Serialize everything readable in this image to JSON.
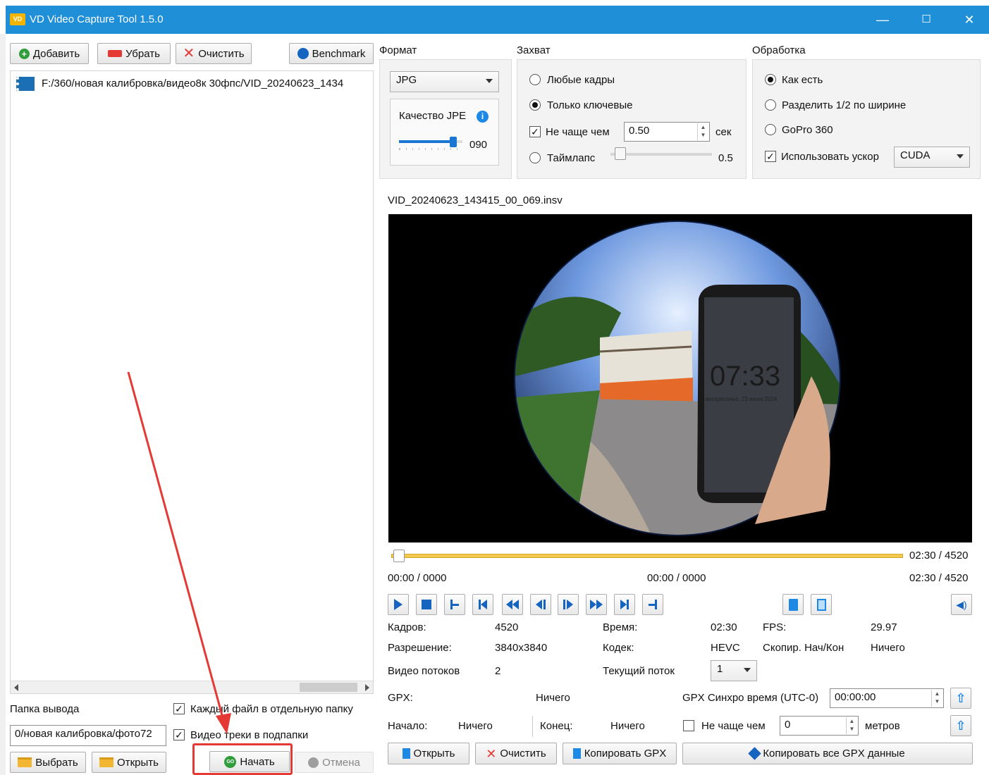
{
  "window": {
    "app_logo": "VD",
    "title": "VD Video Capture Tool 1.5.0",
    "controls": {
      "minimize": "—",
      "maximize": "☐",
      "close": "✕"
    }
  },
  "toolbar": {
    "add_label": "Добавить",
    "remove_label": "Убрать",
    "clear_label": "Очистить",
    "benchmark_label": "Benchmark"
  },
  "file_list": {
    "items": [
      {
        "path": "F:/360/новая калибровка/видео8к 30фпс/VID_20240623_1434"
      }
    ]
  },
  "output": {
    "folder_label": "Папка вывода",
    "folder_value": "0/новая калибровка/фото72",
    "each_file_folder_label": "Каждый файл в отдельную папку",
    "each_file_folder_checked": true,
    "video_tracks_label": "Видео треки в подпапки",
    "video_tracks_checked": true,
    "choose_label": "Выбрать",
    "open_label": "Открыть",
    "start_label": "Начать",
    "start_icon": "GO",
    "cancel_label": "Отмена"
  },
  "format": {
    "group_label": "Формат",
    "selected": "JPG",
    "quality_label": "Качество JPE",
    "quality_value": "090",
    "quality_level": 90
  },
  "capture": {
    "group_label": "Захват",
    "any_frames_label": "Любые кадры",
    "key_only_label": "Только ключевые",
    "selected_mode": "key_only",
    "not_more_label": "Не чаще чем",
    "not_more_checked": true,
    "not_more_value": "0.50",
    "unit_label": "сек",
    "timelapse_label": "Таймлапс",
    "timelapse_value": "0.5",
    "timelapse_level": 0.05
  },
  "processing": {
    "group_label": "Обработка",
    "as_is_label": "Как есть",
    "split_label": "Разделить 1/2 по ширине",
    "gopro_label": "GoPro 360",
    "selected_mode": "as_is",
    "accel_label": "Использовать ускор",
    "accel_checked": true,
    "accel_value": "CUDA"
  },
  "preview": {
    "filename": "VID_20240623_143415_00_069.insv",
    "phone_time": "07:33",
    "phone_date": "воскресенье, 23 июня 2024",
    "slider_time": "02:30 / 4520",
    "slider_progress": 0.01,
    "pos_start": "00:00 / 0000",
    "pos_mid": "00:00 / 0000",
    "pos_end": "02:30 / 4520"
  },
  "info": {
    "frames_label": "Кадров:",
    "frames_value": "4520",
    "time_label": "Время:",
    "time_value": "02:30",
    "fps_label": "FPS:",
    "fps_value": "29.97",
    "resolution_label": "Разрешение:",
    "resolution_value": "3840x3840",
    "codec_label": "Кодек:",
    "codec_value": "HEVC",
    "copy_label": "Скопир. Нач/Кон",
    "copy_value": "Ничего",
    "streams_label": "Видео потоков",
    "streams_value": "2",
    "current_stream_label": "Текущий поток",
    "current_stream_value": "1"
  },
  "gpx": {
    "label": "GPX:",
    "value": "Ничего",
    "sync_label": "GPX Синхро время (UTC-0)",
    "sync_value": "00:00:00",
    "start_label": "Начало:",
    "start_value": "Ничего",
    "end_label": "Конец:",
    "end_value": "Ничего",
    "not_more_label": "Не чаще чем",
    "not_more_checked": false,
    "not_more_value": "0",
    "unit_label": "метров",
    "open_label": "Открыть",
    "clear_label": "Очистить",
    "copy_label": "Копировать GPX",
    "copy_all_label": "Копировать все GPX данные"
  },
  "colors": {
    "titlebar": "#1f8fd8",
    "accent": "#1565c0",
    "annotation": "#e53935",
    "timeline": "#f2c94c"
  }
}
